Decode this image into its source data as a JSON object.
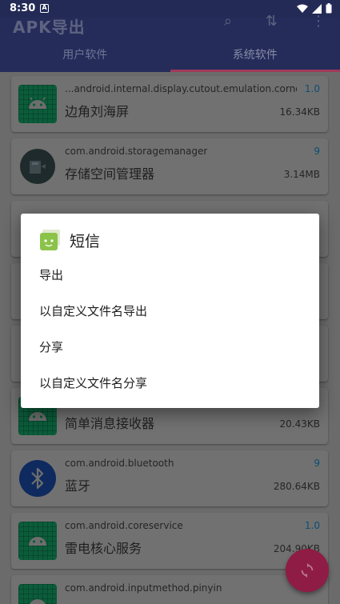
{
  "status_bar": {
    "time": "8:30",
    "notification_letter": "A"
  },
  "app_bar": {
    "title": "APK导出"
  },
  "tabs": [
    {
      "label": "用户软件",
      "active": false
    },
    {
      "label": "系统软件",
      "active": true
    }
  ],
  "apps": [
    {
      "package": "...android.internal.display.cutout.emulation.corner",
      "name": "边角刘海屏",
      "version": "1.0",
      "size": "16.34KB",
      "icon": "android-icon"
    },
    {
      "package": "com.android.storagemanager",
      "name": "存储空间管理器",
      "version": "9",
      "size": "3.14MB",
      "icon": "storage-manager-icon"
    },
    {
      "package": "",
      "name": "简单消息接收器",
      "version": "",
      "size": "20.43KB",
      "icon": "android-icon"
    },
    {
      "package": "com.android.bluetooth",
      "name": "蓝牙",
      "version": "9",
      "size": "280.64KB",
      "icon": "bluetooth-icon"
    },
    {
      "package": "com.android.coreservice",
      "name": "雷电核心服务",
      "version": "1.0",
      "size": "204.90KB",
      "icon": "android-icon"
    },
    {
      "package": "com.android.inputmethod.pinyin",
      "name": "",
      "version": "",
      "size": "",
      "icon": "android-icon"
    }
  ],
  "dialog": {
    "title": "短信",
    "options": [
      "导出",
      "以自定义文件名导出",
      "分享",
      "以自定义文件名分享"
    ]
  },
  "colors": {
    "primary": "#3949ab",
    "accent": "#e91e63",
    "app_icon_green": "#1b9a59"
  }
}
